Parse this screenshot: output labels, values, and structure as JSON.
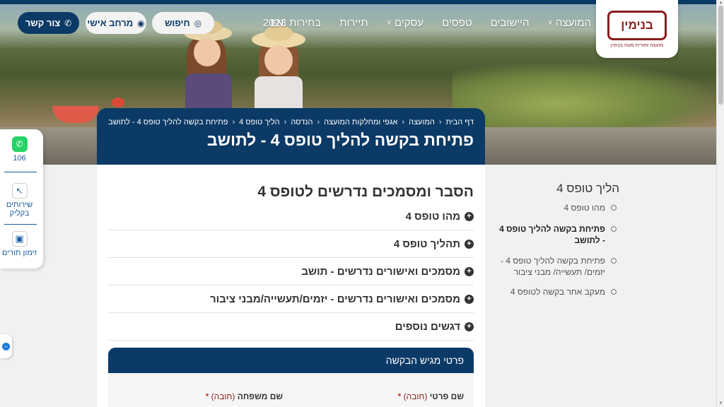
{
  "logo": {
    "name": "בנימין",
    "tagline": "מועצה אזורית מטה בנימין"
  },
  "nav": {
    "items": [
      {
        "label": "המועצה",
        "dropdown": true
      },
      {
        "label": "היישובים",
        "dropdown": false
      },
      {
        "label": "טפסים",
        "dropdown": false
      },
      {
        "label": "עסקים",
        "dropdown": true
      },
      {
        "label": "תיירות",
        "dropdown": false
      },
      {
        "label": "בחירות 2023",
        "dropdown": false
      }
    ],
    "lang": "EN",
    "search_label": "חיפוש",
    "personal_label": "מרחב אישי",
    "contact_label": "צור קשר"
  },
  "side_panel": {
    "whatsapp_label": "106",
    "services_label_1": "שירותים",
    "services_label_2": "בקליק",
    "appointments_label": "זימון תורים"
  },
  "breadcrumb": [
    "דף הבית",
    "המועצה",
    "אגפי ומחלקות המועצה",
    "הנדסה",
    "הליך טופס 4",
    "פתיחת בקשה להליך טופס 4 - לתושב"
  ],
  "page_title": "פתיחת בקשה להליך טופס 4 - לתושב",
  "main": {
    "section_title": "הסבר ומסמכים נדרשים לטופס 4",
    "accordion": [
      "מהו טופס 4",
      "תהליך טופס 4",
      "מסמכים ואישורים נדרשים - תושב",
      "מסמכים ואישורים נדרשים - יזמים/תעשייה/מבני ציבור",
      "דגשים נוספים"
    ],
    "form_header": "פרטי מגיש הבקשה",
    "first_name_label": "שם פרטי",
    "last_name_label": "שם משפחה",
    "required_text": "(חובה)",
    "required_star": "*"
  },
  "side_nav": {
    "title": "הליך טופס 4",
    "items": [
      {
        "label": "מהו טופס 4",
        "active": false
      },
      {
        "label": "פתיחת בקשה להליך טופס 4 - לתושב",
        "active": true
      },
      {
        "label": "פתיחת בקשה להליך טופס 4 - יזמים/ תעשייה/ מבני ציבור",
        "active": false
      },
      {
        "label": "מעקב אחר בקשה לטופס 4",
        "active": false
      }
    ]
  },
  "colors": {
    "primary": "#0c3a66",
    "brand": "#8b1d1d",
    "link": "#1b5c9e",
    "whatsapp": "#25d366"
  }
}
